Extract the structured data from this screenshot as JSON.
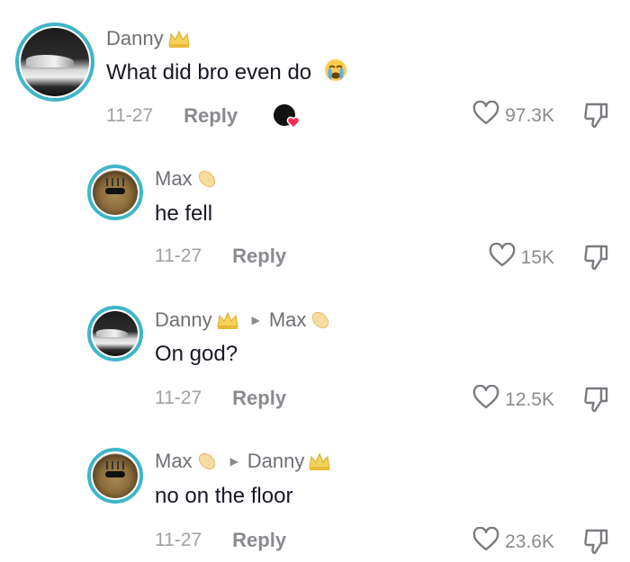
{
  "comments": [
    {
      "username": "Danny",
      "reply_to": "",
      "text": "What did bro even do",
      "date": "11-27",
      "reply_label": "Reply",
      "likes": "97.3K",
      "avatar": "car-photo-avatar",
      "badge": "crown-icon",
      "creator_liked": true,
      "emoji": "crying-face-icon"
    },
    {
      "username": "Max",
      "reply_to": "",
      "text": "he fell",
      "date": "11-27",
      "reply_label": "Reply",
      "likes": "15K",
      "avatar": "cat-sunglasses-avatar",
      "badge": "egg-icon"
    },
    {
      "username": "Danny",
      "reply_to": "Max",
      "text": "On god?",
      "date": "11-27",
      "reply_label": "Reply",
      "likes": "12.5K",
      "avatar": "car-photo-avatar",
      "badge": "crown-icon"
    },
    {
      "username": "Max",
      "reply_to": "Danny",
      "text": "no on the floor",
      "date": "11-27",
      "reply_label": "Reply",
      "likes": "23.6K",
      "avatar": "cat-sunglasses-avatar",
      "badge": "egg-icon"
    }
  ],
  "colors": {
    "avatar_ring": "#3fb6c9",
    "text": "#161823",
    "muted": "#8a8a90",
    "creator_heart": "#fe2c55"
  }
}
